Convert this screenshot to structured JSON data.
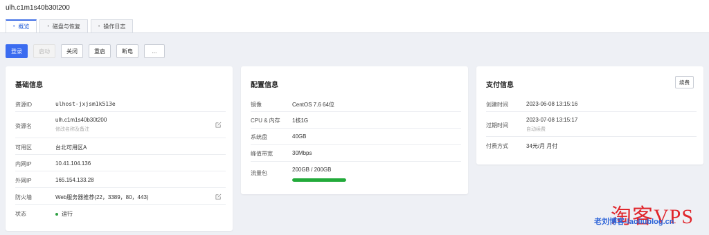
{
  "header": {
    "title": "ulh.c1m1s40b30t200"
  },
  "tabs": [
    {
      "label": "概览",
      "active": true
    },
    {
      "label": "磁盘与恢复",
      "active": false
    },
    {
      "label": "操作日志",
      "active": false
    }
  ],
  "toolbar": {
    "login": "登录",
    "start": "启动",
    "shutdown": "关闭",
    "restart": "重启",
    "poweroff": "断电",
    "more": "..."
  },
  "basic": {
    "title": "基础信息",
    "resource_id_label": "资源ID",
    "resource_id": "ulhost-jxjsm1k513e",
    "name_label": "资源名",
    "name": "ulh.c1m1s40b30t200",
    "name_hint": "修改名称及备注",
    "zone_label": "可用区",
    "zone": "台北可用区A",
    "private_ip_label": "内网IP",
    "private_ip": "10.41.104.136",
    "public_ip_label": "外网IP",
    "public_ip": "165.154.133.28",
    "firewall_label": "防火墙",
    "firewall": "Web服务器推荐(22，3389，80，443)",
    "status_label": "状态",
    "status": "运行",
    "status_color": "#2ea043"
  },
  "config": {
    "title": "配置信息",
    "image_label": "镜像",
    "image": "CentOS 7.6 64位",
    "cpu_label": "CPU & 内存",
    "cpu": "1核1G",
    "disk_label": "系统盘",
    "disk": "40GB",
    "bandwidth_label": "峰值带宽",
    "bandwidth": "30Mbps",
    "traffic_label": "流量包",
    "traffic": "200GB / 200GB",
    "traffic_fraction": 1.0,
    "traffic_color": "#22aa3a"
  },
  "payment": {
    "title": "支付信息",
    "renew_button": "续费",
    "created_label": "创建时间",
    "created": "2023-06-08 13:15:16",
    "expire_label": "过期时间",
    "expire": "2023-07-08 13:15:17",
    "auto_renew": "自动续费",
    "method_label": "付费方式",
    "method": "34元/月 月付"
  },
  "watermark": {
    "big": "淘客VPS",
    "small": "老刘博客-laoliublog.cn"
  },
  "colors": {
    "accent": "#3b6cf0",
    "background": "#eef0f5"
  }
}
